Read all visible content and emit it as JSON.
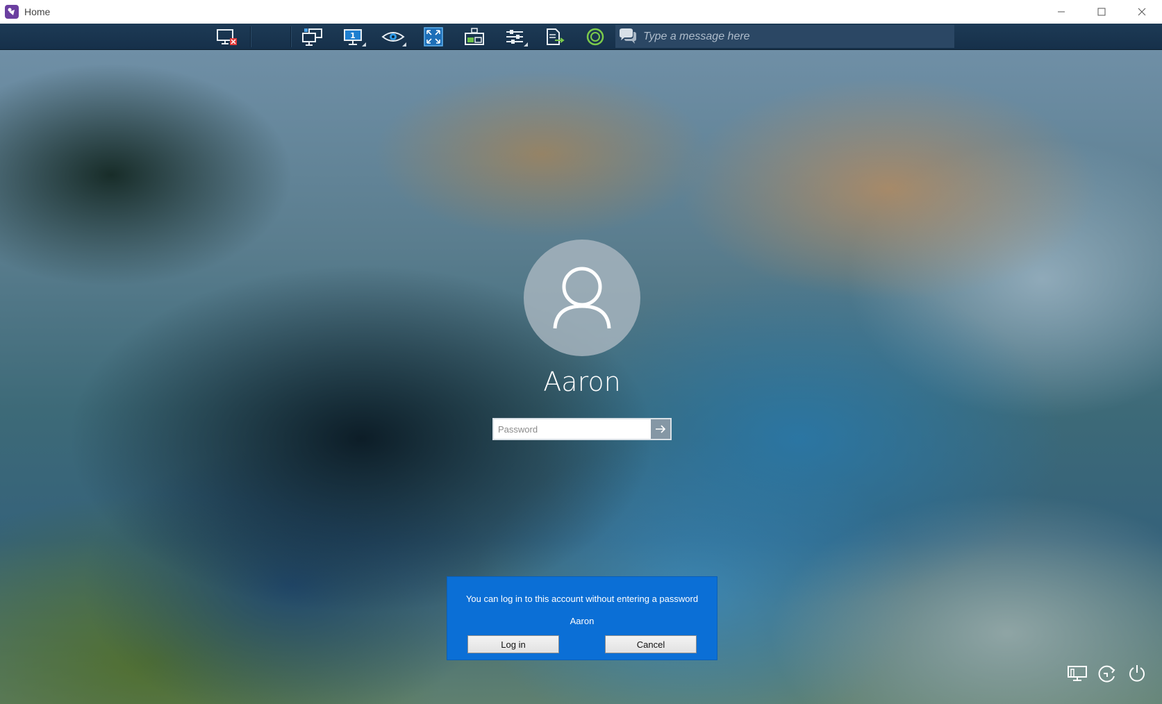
{
  "window": {
    "title": "Home",
    "controls": [
      "minimize-icon",
      "maximize-icon",
      "close-icon"
    ]
  },
  "toolbar": {
    "buttons": [
      {
        "name": "disconnect-button",
        "icon": "monitor-disconnect-icon"
      },
      {
        "name": "switch-session-button",
        "icon": "multi-monitor-icon"
      },
      {
        "name": "monitor-select-button",
        "icon": "monitor-number-icon",
        "caret": true
      },
      {
        "name": "view-mode-button",
        "icon": "eye-icon",
        "caret": true
      },
      {
        "name": "fullscreen-button",
        "icon": "fullscreen-icon"
      },
      {
        "name": "remote-desktop-button",
        "icon": "remote-desktop-icon"
      },
      {
        "name": "settings-button",
        "icon": "sliders-icon",
        "caret": true
      },
      {
        "name": "file-transfer-button",
        "icon": "file-transfer-icon"
      },
      {
        "name": "record-button",
        "icon": "record-circle-icon"
      }
    ],
    "chat": {
      "icon": "chat-bubble-icon",
      "placeholder": "Type a message here"
    }
  },
  "lockscreen": {
    "avatar_icon": "user-icon",
    "username": "Aaron",
    "password_placeholder": "Password",
    "submit_icon": "arrow-right-icon",
    "corner_icons": [
      "network-icon",
      "ease-of-access-icon",
      "power-icon"
    ]
  },
  "dialog": {
    "message": "You can log in to this account without entering a password",
    "user": "Aaron",
    "login_label": "Log in",
    "cancel_label": "Cancel",
    "color": "#0b6fd6"
  }
}
